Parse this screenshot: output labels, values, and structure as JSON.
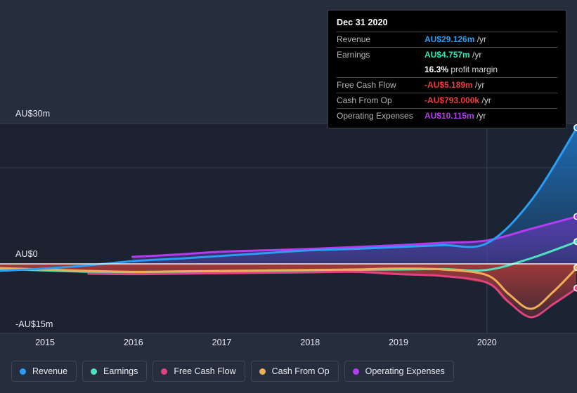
{
  "theme": {
    "background": "#262d3d",
    "plot_background": "#1c2230",
    "grid_color": "#39414f",
    "zero_line_color": "#ffffff",
    "axis_text_color": "#e8eaee",
    "forecast_band_color": "#1e2738"
  },
  "tooltip": {
    "title": "Dec 31 2020",
    "rows": [
      {
        "key": "Revenue",
        "value": "AU$29.126m",
        "unit": "/yr",
        "color": "#2a9df4"
      },
      {
        "key": "Earnings",
        "value": "AU$4.757m",
        "unit": "/yr",
        "color": "#2ee6b6"
      },
      {
        "key": "",
        "value": "16.3%",
        "unit": "profit margin",
        "color": "#ffffff"
      },
      {
        "key": "Free Cash Flow",
        "value": "-AU$5.189m",
        "unit": "/yr",
        "color": "#ef3b3b"
      },
      {
        "key": "Cash From Op",
        "value": "-AU$793.000k",
        "unit": "/yr",
        "color": "#ef3b3b"
      },
      {
        "key": "Operating Expenses",
        "value": "AU$10.115m",
        "unit": "/yr",
        "color": "#b43cf0"
      }
    ]
  },
  "legend": {
    "items": [
      {
        "label": "Revenue",
        "color": "#2a9df4"
      },
      {
        "label": "Earnings",
        "color": "#4fe0c0"
      },
      {
        "label": "Free Cash Flow",
        "color": "#e0437f"
      },
      {
        "label": "Cash From Op",
        "color": "#eead57"
      },
      {
        "label": "Operating Expenses",
        "color": "#b43cf0"
      }
    ]
  },
  "chart_data": {
    "type": "area",
    "title": "",
    "xlabel": "",
    "ylabel": "",
    "currency": "AU$",
    "grid": true,
    "legend_position": "bottom",
    "y_axis": {
      "ticks": [
        {
          "label": "AU$30m",
          "value": 30
        },
        {
          "label": "AU$0",
          "value": 0
        },
        {
          "label": "-AU$15m",
          "value": -15
        }
      ],
      "ylim": [
        -16.5,
        30
      ],
      "unit": "AU$ millions",
      "zero_line": 0
    },
    "x_axis": {
      "tick_labels": [
        "2015",
        "2016",
        "2017",
        "2018",
        "2019",
        "2020"
      ],
      "tick_values": [
        2015,
        2016,
        2017,
        2018,
        2019,
        2020
      ],
      "xlim": [
        2014.49,
        2021.02
      ],
      "forecast_starts": 2020.0
    },
    "series": [
      {
        "name": "Revenue",
        "color": "#2a9df4",
        "x": [
          2014.49,
          2015.0,
          2015.5,
          2016.0,
          2016.5,
          2017.0,
          2017.5,
          2018.0,
          2018.5,
          2019.0,
          2019.5,
          2020.0,
          2020.5,
          2021.02
        ],
        "values": [
          -1.5,
          -1.0,
          -0.3,
          0.6,
          1.1,
          1.7,
          2.3,
          2.9,
          3.2,
          3.6,
          4.0,
          4.4,
          13.5,
          29.126
        ]
      },
      {
        "name": "Operating Expenses",
        "color": "#b43cf0",
        "x": [
          2015.99,
          2016.5,
          2017.0,
          2017.5,
          2018.0,
          2018.5,
          2019.0,
          2019.5,
          2020.0,
          2020.5,
          2021.02
        ],
        "values": [
          1.5,
          2.0,
          2.6,
          2.9,
          3.2,
          3.6,
          4.0,
          4.5,
          5.0,
          7.5,
          10.115
        ]
      },
      {
        "name": "Earnings",
        "color": "#4fe0c0",
        "x": [
          2014.49,
          2015.0,
          2015.5,
          2016.0,
          2016.5,
          2017.0,
          2017.5,
          2018.0,
          2018.5,
          2019.0,
          2019.5,
          2020.0,
          2020.5,
          2021.02
        ],
        "values": [
          -1.1,
          -1.4,
          -1.7,
          -1.9,
          -1.8,
          -1.6,
          -1.5,
          -1.5,
          -1.3,
          -1.2,
          -1.1,
          -1.3,
          1.2,
          4.757
        ]
      },
      {
        "name": "Cash From Op",
        "color": "#eead57",
        "x": [
          2014.49,
          2015.0,
          2015.5,
          2016.0,
          2016.5,
          2017.0,
          2017.5,
          2018.0,
          2018.5,
          2019.0,
          2019.5,
          2020.0,
          2020.25,
          2020.5,
          2020.75,
          2021.02
        ],
        "values": [
          -0.9,
          -1.2,
          -1.5,
          -1.7,
          -1.6,
          -1.5,
          -1.4,
          -1.3,
          -1.2,
          -1.0,
          -1.2,
          -2.4,
          -6.5,
          -9.6,
          -6.0,
          -0.793
        ]
      },
      {
        "name": "Free Cash Flow",
        "color": "#e0437f",
        "x": [
          2015.49,
          2016.0,
          2016.5,
          2017.0,
          2017.5,
          2018.0,
          2018.5,
          2019.0,
          2019.5,
          2020.0,
          2020.25,
          2020.5,
          2020.75,
          2021.02
        ],
        "values": [
          -2.1,
          -2.2,
          -2.1,
          -2.0,
          -1.9,
          -1.8,
          -1.7,
          -2.2,
          -2.6,
          -4.0,
          -8.2,
          -11.4,
          -8.6,
          -5.189
        ]
      }
    ],
    "endpoint_markers": [
      {
        "name": "Revenue",
        "value": 29.126
      },
      {
        "name": "Operating Expenses",
        "value": 10.115
      },
      {
        "name": "Earnings",
        "value": 4.757
      },
      {
        "name": "Cash From Op",
        "value": -0.793
      },
      {
        "name": "Free Cash Flow",
        "value": -5.189
      }
    ]
  }
}
